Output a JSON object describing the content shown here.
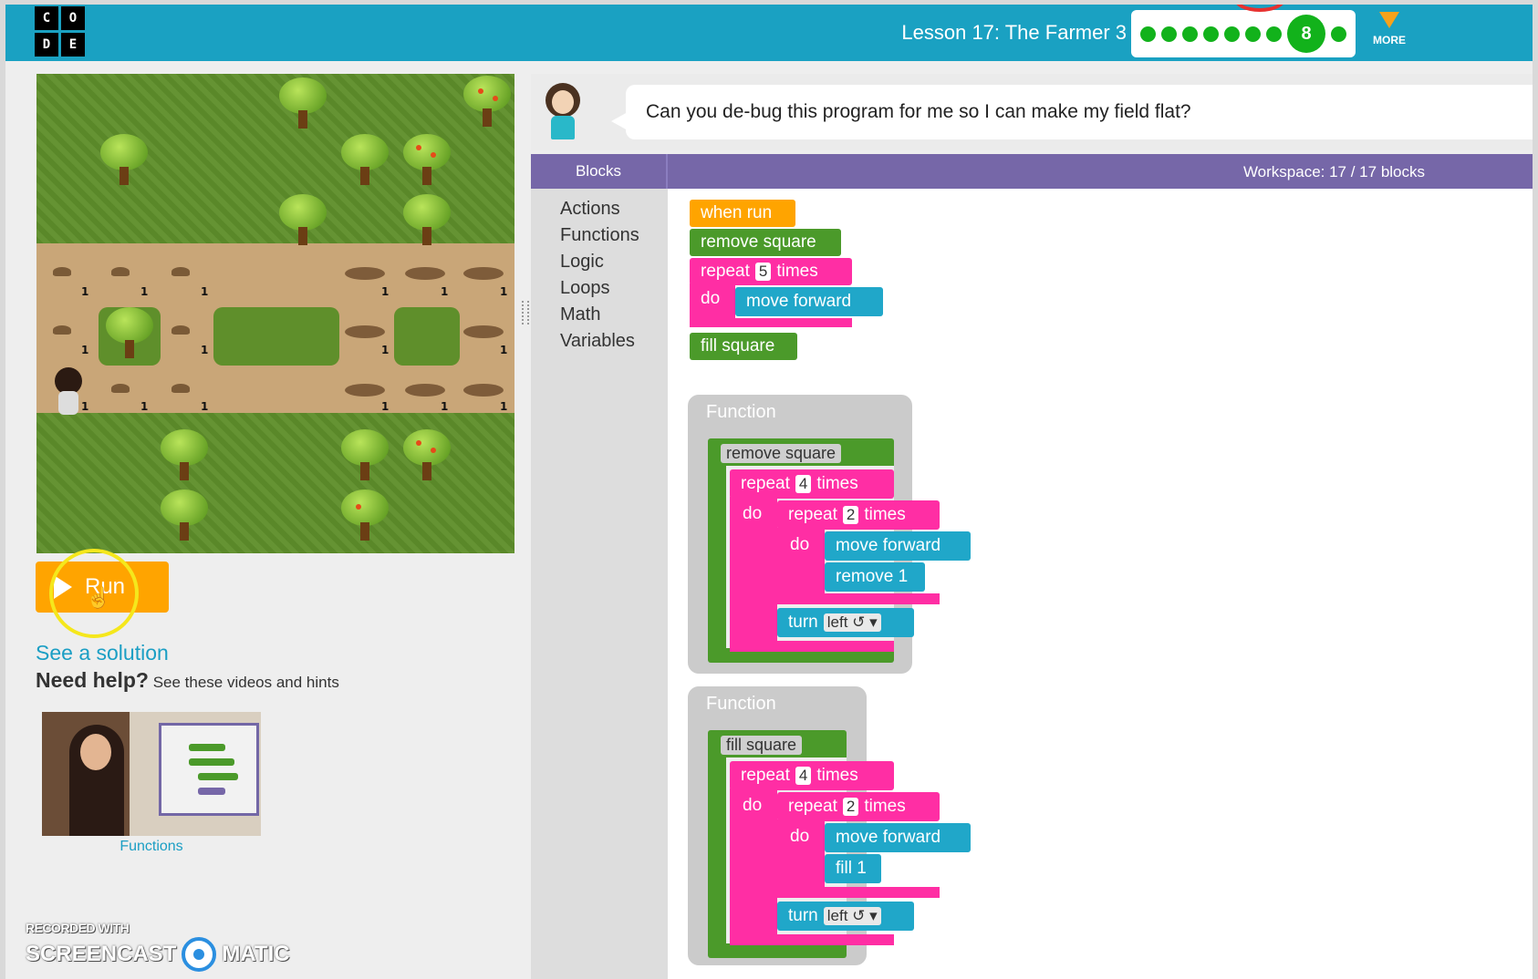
{
  "header": {
    "logo_letters": [
      "C",
      "O",
      "D",
      "E"
    ],
    "lesson_title": "Lesson 17: The Farmer 3",
    "progress": {
      "completed_dots": 7,
      "current": "8",
      "after_dots": 1
    },
    "more_label": "MORE",
    "colors": {
      "bar": "#1aa1c2",
      "dot": "#12b21b",
      "more": "#f7a21b"
    }
  },
  "maze": {
    "cell_numbers": [
      "1",
      "1",
      "1",
      "1",
      "1",
      "1",
      "1",
      "1",
      "1",
      "1",
      "1",
      "1",
      "1",
      "1",
      "1",
      "1",
      "1",
      "1"
    ]
  },
  "controls": {
    "run_label": "Run",
    "solution_link": "See a solution",
    "help_bold": "Need help?",
    "help_text": "See these videos and hints",
    "video_label": "Functions"
  },
  "watermark": {
    "line1": "RECORDED WITH",
    "left": "SCREENCAST",
    "right": "MATIC"
  },
  "instructions": {
    "text": "Can you de-bug this program for me so I can make my field flat?"
  },
  "workspace_header": {
    "blocks_tab": "Blocks",
    "count": "Workspace: 17 / 17 blocks"
  },
  "toolbox": [
    "Actions",
    "Functions",
    "Logic",
    "Loops",
    "Math",
    "Variables"
  ],
  "program": {
    "when_run": "when run",
    "remove_square": "remove square",
    "repeat_word": "repeat",
    "times_word": "times",
    "do_word": "do",
    "repeat_count": "5",
    "move_forward": "move forward",
    "fill_square": "fill square"
  },
  "functions": [
    {
      "title": "Function",
      "name": "remove square",
      "outer_repeat": "4",
      "inner_repeat": "2",
      "action_1": "move forward",
      "action_2": "remove 1",
      "turn_word": "turn",
      "turn_dir": "left ↺ ▾"
    },
    {
      "title": "Function",
      "name": "fill square",
      "outer_repeat": "4",
      "inner_repeat": "2",
      "action_1": "move forward",
      "action_2": "fill 1",
      "turn_word": "turn",
      "turn_dir": "left ↺ ▾"
    }
  ]
}
